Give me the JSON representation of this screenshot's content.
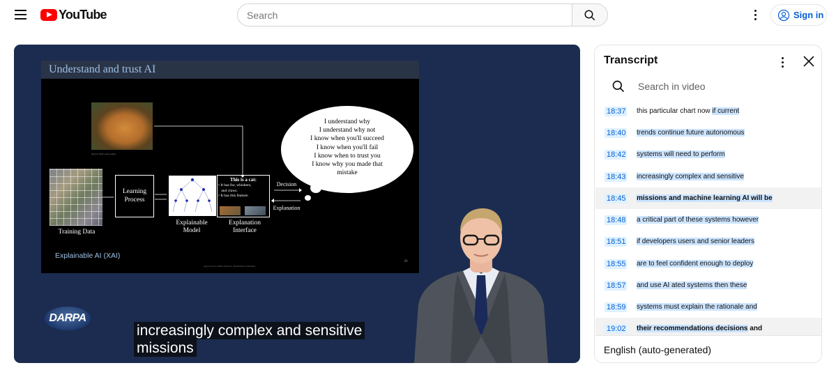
{
  "header": {
    "logo_text": "YouTube",
    "search_placeholder": "Search",
    "signin_label": "Sign in",
    "accent_color": "#065fd4",
    "brand_color": "#ff0000"
  },
  "video": {
    "slide": {
      "title": "Understand and trust AI",
      "cat_credit": "Source: RFG Lucky Faces",
      "training_data_label": "Training Data",
      "learning_process_label": "Learning\nProcess",
      "explainable_model_label": "Explainable\nModel",
      "explanation_interface_label": "Explanation\nInterface",
      "cat_box_title": "This is a cat:",
      "cat_box_lines": "• It has fur, whiskers,\n   and claws.\n• It has this feature:",
      "decision_label": "Decision",
      "explanation_label": "Explanation",
      "thought_text": "I understand why\nI understand why not\nI know when you'll succeed\nI know when you'll fail\nI know when to trust you\nI know why you made that\nmistake",
      "footer_label": "Explainable AI (XAI)",
      "approval_text": "Approved for Public Release, Distribution Unlimited",
      "page_number": "26"
    },
    "logo": "DARPA",
    "caption_line1": "increasingly complex and sensitive",
    "caption_line2": "missions"
  },
  "transcript": {
    "title": "Transcript",
    "search_placeholder": "Search in video",
    "language": "English (auto-generated)",
    "segments": [
      {
        "time": "18:37",
        "text": "this particular chart now ",
        "hl": "if current"
      },
      {
        "time": "18:40",
        "text": "",
        "hl": "trends continue future autonomous"
      },
      {
        "time": "18:42",
        "text": "",
        "hl": "systems will need to perform"
      },
      {
        "time": "18:43",
        "text": "",
        "hl": "increasingly complex and sensitive"
      },
      {
        "time": "18:45",
        "text": "",
        "hl": "missions and machine learning AI will be",
        "active": true
      },
      {
        "time": "18:48",
        "text": "",
        "hl": "a critical part of these systems however"
      },
      {
        "time": "18:51",
        "text": "",
        "hl": "if developers users and senior leaders"
      },
      {
        "time": "18:55",
        "text": "",
        "hl": "are to feel confident enough to deploy"
      },
      {
        "time": "18:57",
        "text": "",
        "hl": "and use AI ated systems then these"
      },
      {
        "time": "18:59",
        "text": "",
        "hl": "systems must explain the rationale and"
      },
      {
        "time": "19:02",
        "text": "",
        "hl": "their recommendations decisions",
        "tail": " and",
        "active": true
      }
    ]
  }
}
